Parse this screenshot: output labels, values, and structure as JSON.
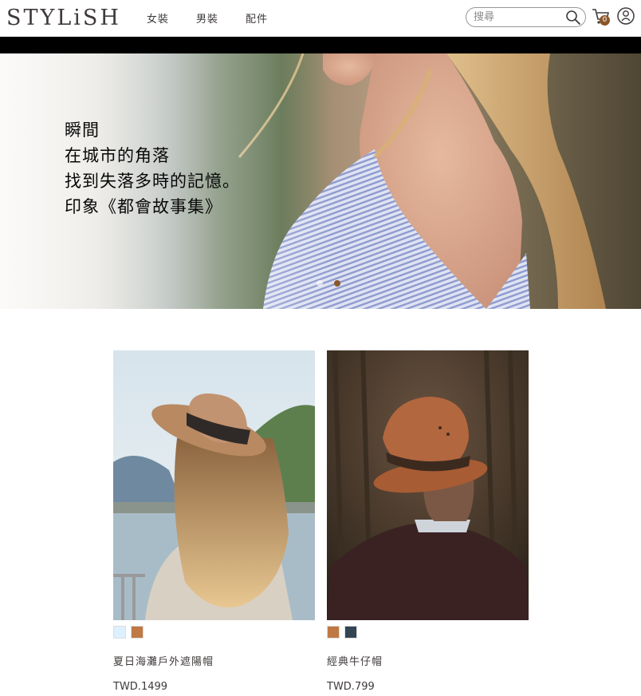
{
  "header": {
    "logo": "STYLiSH",
    "nav": [
      "女裝",
      "男裝",
      "配件"
    ],
    "search_placeholder": "搜尋",
    "cart_count": "0"
  },
  "hero": {
    "lines": [
      "瞬間",
      "在城市的角落",
      "找到失落多時的記憶。",
      "印象《都會故事集》"
    ],
    "dots": 2,
    "active_dot": 2
  },
  "products": [
    {
      "name": "夏日海灘戶外遮陽帽",
      "price": "TWD.1499",
      "colors": [
        "#ddf0ff",
        "#c07844"
      ]
    },
    {
      "name": "經典牛仔帽",
      "price": "TWD.799",
      "colors": [
        "#c07844",
        "#334455"
      ]
    }
  ],
  "icons": [
    "search-icon",
    "cart-icon",
    "member-icon"
  ],
  "colors": {
    "accent": "#8b572a",
    "text": "#3f3a3a"
  }
}
